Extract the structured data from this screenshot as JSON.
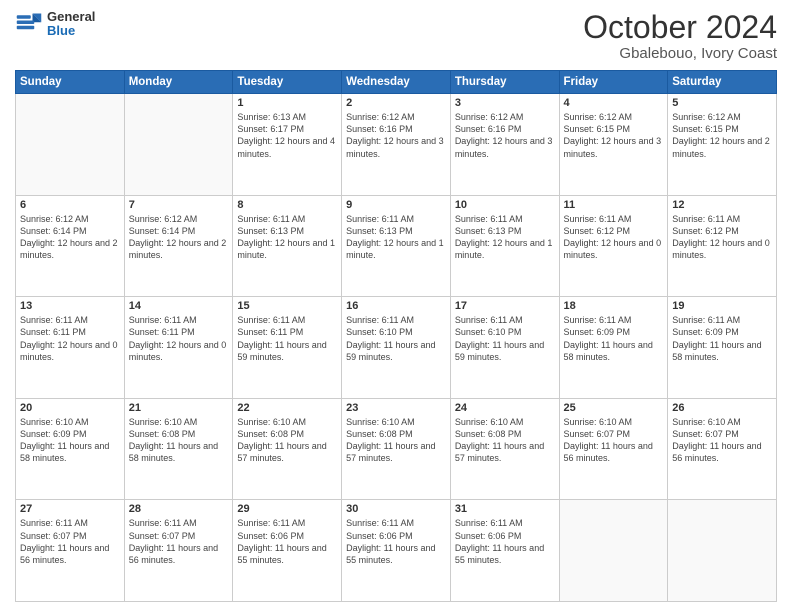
{
  "header": {
    "title": "October 2024",
    "subtitle": "Gbalebouo, Ivory Coast",
    "logo_general": "General",
    "logo_blue": "Blue"
  },
  "days_of_week": [
    "Sunday",
    "Monday",
    "Tuesday",
    "Wednesday",
    "Thursday",
    "Friday",
    "Saturday"
  ],
  "weeks": [
    [
      {
        "day": "",
        "info": ""
      },
      {
        "day": "",
        "info": ""
      },
      {
        "day": "1",
        "info": "Sunrise: 6:13 AM\nSunset: 6:17 PM\nDaylight: 12 hours and 4 minutes."
      },
      {
        "day": "2",
        "info": "Sunrise: 6:12 AM\nSunset: 6:16 PM\nDaylight: 12 hours and 3 minutes."
      },
      {
        "day": "3",
        "info": "Sunrise: 6:12 AM\nSunset: 6:16 PM\nDaylight: 12 hours and 3 minutes."
      },
      {
        "day": "4",
        "info": "Sunrise: 6:12 AM\nSunset: 6:15 PM\nDaylight: 12 hours and 3 minutes."
      },
      {
        "day": "5",
        "info": "Sunrise: 6:12 AM\nSunset: 6:15 PM\nDaylight: 12 hours and 2 minutes."
      }
    ],
    [
      {
        "day": "6",
        "info": "Sunrise: 6:12 AM\nSunset: 6:14 PM\nDaylight: 12 hours and 2 minutes."
      },
      {
        "day": "7",
        "info": "Sunrise: 6:12 AM\nSunset: 6:14 PM\nDaylight: 12 hours and 2 minutes."
      },
      {
        "day": "8",
        "info": "Sunrise: 6:11 AM\nSunset: 6:13 PM\nDaylight: 12 hours and 1 minute."
      },
      {
        "day": "9",
        "info": "Sunrise: 6:11 AM\nSunset: 6:13 PM\nDaylight: 12 hours and 1 minute."
      },
      {
        "day": "10",
        "info": "Sunrise: 6:11 AM\nSunset: 6:13 PM\nDaylight: 12 hours and 1 minute."
      },
      {
        "day": "11",
        "info": "Sunrise: 6:11 AM\nSunset: 6:12 PM\nDaylight: 12 hours and 0 minutes."
      },
      {
        "day": "12",
        "info": "Sunrise: 6:11 AM\nSunset: 6:12 PM\nDaylight: 12 hours and 0 minutes."
      }
    ],
    [
      {
        "day": "13",
        "info": "Sunrise: 6:11 AM\nSunset: 6:11 PM\nDaylight: 12 hours and 0 minutes."
      },
      {
        "day": "14",
        "info": "Sunrise: 6:11 AM\nSunset: 6:11 PM\nDaylight: 12 hours and 0 minutes."
      },
      {
        "day": "15",
        "info": "Sunrise: 6:11 AM\nSunset: 6:11 PM\nDaylight: 11 hours and 59 minutes."
      },
      {
        "day": "16",
        "info": "Sunrise: 6:11 AM\nSunset: 6:10 PM\nDaylight: 11 hours and 59 minutes."
      },
      {
        "day": "17",
        "info": "Sunrise: 6:11 AM\nSunset: 6:10 PM\nDaylight: 11 hours and 59 minutes."
      },
      {
        "day": "18",
        "info": "Sunrise: 6:11 AM\nSunset: 6:09 PM\nDaylight: 11 hours and 58 minutes."
      },
      {
        "day": "19",
        "info": "Sunrise: 6:11 AM\nSunset: 6:09 PM\nDaylight: 11 hours and 58 minutes."
      }
    ],
    [
      {
        "day": "20",
        "info": "Sunrise: 6:10 AM\nSunset: 6:09 PM\nDaylight: 11 hours and 58 minutes."
      },
      {
        "day": "21",
        "info": "Sunrise: 6:10 AM\nSunset: 6:08 PM\nDaylight: 11 hours and 58 minutes."
      },
      {
        "day": "22",
        "info": "Sunrise: 6:10 AM\nSunset: 6:08 PM\nDaylight: 11 hours and 57 minutes."
      },
      {
        "day": "23",
        "info": "Sunrise: 6:10 AM\nSunset: 6:08 PM\nDaylight: 11 hours and 57 minutes."
      },
      {
        "day": "24",
        "info": "Sunrise: 6:10 AM\nSunset: 6:08 PM\nDaylight: 11 hours and 57 minutes."
      },
      {
        "day": "25",
        "info": "Sunrise: 6:10 AM\nSunset: 6:07 PM\nDaylight: 11 hours and 56 minutes."
      },
      {
        "day": "26",
        "info": "Sunrise: 6:10 AM\nSunset: 6:07 PM\nDaylight: 11 hours and 56 minutes."
      }
    ],
    [
      {
        "day": "27",
        "info": "Sunrise: 6:11 AM\nSunset: 6:07 PM\nDaylight: 11 hours and 56 minutes."
      },
      {
        "day": "28",
        "info": "Sunrise: 6:11 AM\nSunset: 6:07 PM\nDaylight: 11 hours and 56 minutes."
      },
      {
        "day": "29",
        "info": "Sunrise: 6:11 AM\nSunset: 6:06 PM\nDaylight: 11 hours and 55 minutes."
      },
      {
        "day": "30",
        "info": "Sunrise: 6:11 AM\nSunset: 6:06 PM\nDaylight: 11 hours and 55 minutes."
      },
      {
        "day": "31",
        "info": "Sunrise: 6:11 AM\nSunset: 6:06 PM\nDaylight: 11 hours and 55 minutes."
      },
      {
        "day": "",
        "info": ""
      },
      {
        "day": "",
        "info": ""
      }
    ]
  ]
}
